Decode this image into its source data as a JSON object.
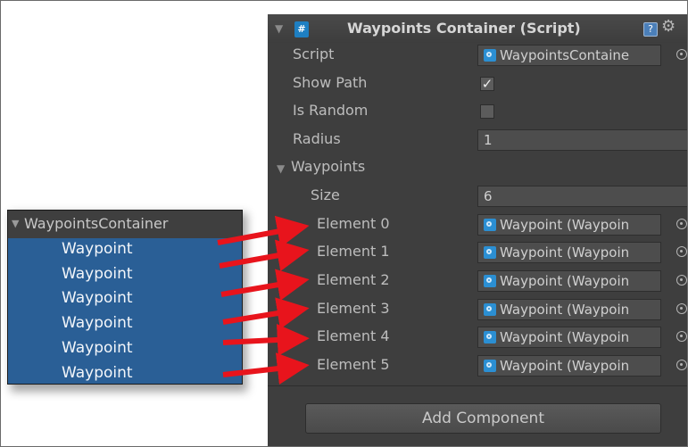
{
  "inspector": {
    "component_title": "Waypoints Container (Script)",
    "fields": {
      "script_label": "Script",
      "script_value": "WaypointsContaine",
      "show_path_label": "Show Path",
      "show_path_checked": true,
      "is_random_label": "Is Random",
      "is_random_checked": false,
      "radius_label": "Radius",
      "radius_value": "1",
      "waypoints_label": "Waypoints",
      "size_label": "Size",
      "size_value": "6"
    },
    "elements": [
      {
        "label": "Element 0",
        "value": "Waypoint (Waypoin"
      },
      {
        "label": "Element 1",
        "value": "Waypoint (Waypoin"
      },
      {
        "label": "Element 2",
        "value": "Waypoint (Waypoin"
      },
      {
        "label": "Element 3",
        "value": "Waypoint (Waypoin"
      },
      {
        "label": "Element 4",
        "value": "Waypoint (Waypoin"
      },
      {
        "label": "Element 5",
        "value": "Waypoint (Waypoin"
      }
    ],
    "add_component_label": "Add Component"
  },
  "hierarchy": {
    "root": "WaypointsContainer",
    "children": [
      "Waypoint",
      "Waypoint",
      "Waypoint",
      "Waypoint",
      "Waypoint",
      "Waypoint"
    ]
  },
  "colors": {
    "inspector_bg": "#3e3e3e",
    "hierarchy_selection": "#2a5f96",
    "arrow": "#e8141c"
  }
}
